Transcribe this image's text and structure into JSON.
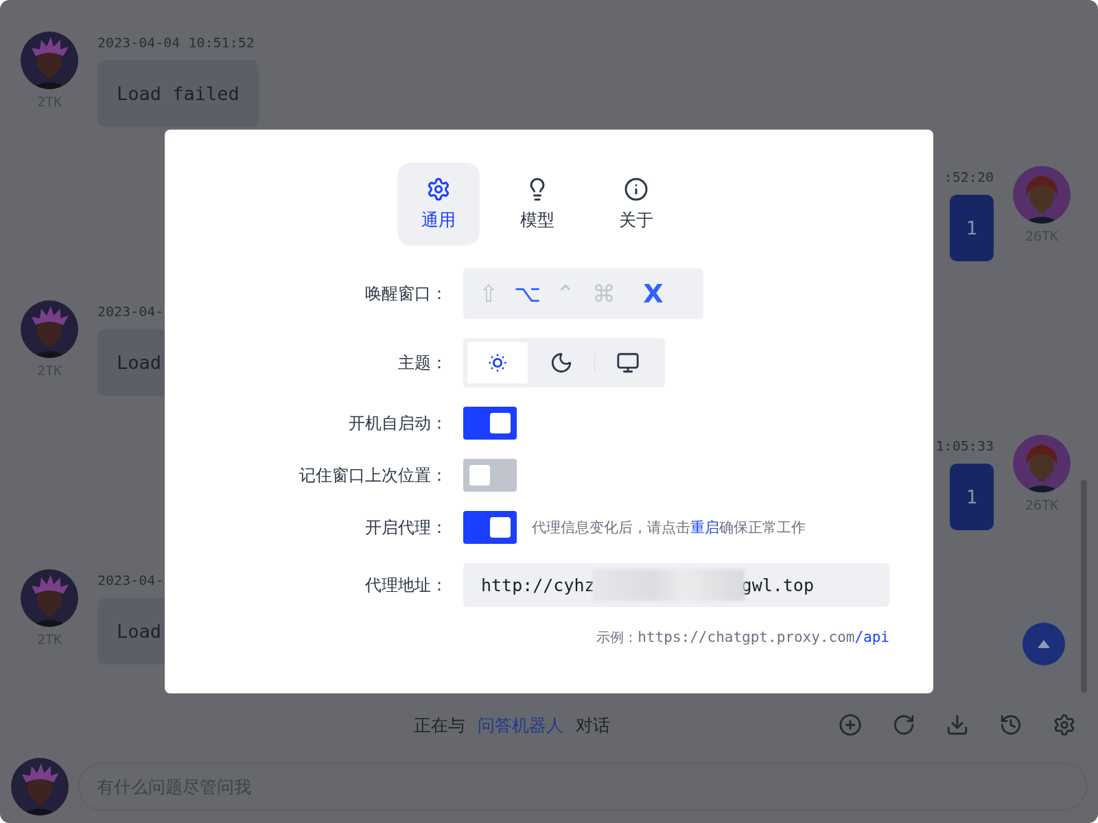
{
  "messages": [
    {
      "kind": "received",
      "time": "2023-04-04 10:51:52",
      "text": "Load failed",
      "tokens": "2TK"
    },
    {
      "kind": "sent",
      "time": ":52:20",
      "text": "1",
      "tokens": "26TK"
    },
    {
      "kind": "received",
      "time": "2023-04-",
      "text": "Load",
      "tokens": "2TK"
    },
    {
      "kind": "sent",
      "time": "1:05:33",
      "text": "1",
      "tokens": "26TK"
    },
    {
      "kind": "received",
      "time": "2023-04-",
      "text": "Load",
      "tokens": "2TK"
    }
  ],
  "status": {
    "prefix": "正在与",
    "bot": "问答机器人",
    "suffix": "对话"
  },
  "input": {
    "placeholder": "有什么问题尽管问我"
  },
  "settings": {
    "tabs": [
      {
        "label": "通用",
        "selected": true
      },
      {
        "label": "模型",
        "selected": false
      },
      {
        "label": "关于",
        "selected": false
      }
    ],
    "rows": [
      {
        "kind": "shortcut",
        "label": "唤醒窗口：",
        "keys": [
          {
            "symbol": "⇧",
            "on": false
          },
          {
            "symbol": "⌥",
            "on": true
          },
          {
            "symbol": "⌃",
            "on": false
          },
          {
            "symbol": "⌘",
            "on": false
          },
          {
            "symbol": "X",
            "on": true
          }
        ]
      },
      {
        "kind": "theme",
        "label": "主题：",
        "options": [
          {
            "selected": true
          },
          {
            "selected": false
          },
          {
            "selected": false
          }
        ]
      },
      {
        "kind": "toggle",
        "label": "开机自启动：",
        "on": true
      },
      {
        "kind": "toggle",
        "label": "记住窗口上次位置：",
        "on": false
      },
      {
        "kind": "toggle",
        "label": "开启代理：",
        "on": true,
        "hint": {
          "before": "代理信息变化后，请点击",
          "link": "重启",
          "after": "确保正常工作"
        }
      },
      {
        "kind": "field",
        "label": "代理地址：",
        "value_start": "http://cyhz",
        "value_end": "gwl.top"
      },
      {
        "kind": "example",
        "label": "示例：",
        "url": "https://chatgpt.proxy.com",
        "suffix": "/api"
      }
    ]
  }
}
